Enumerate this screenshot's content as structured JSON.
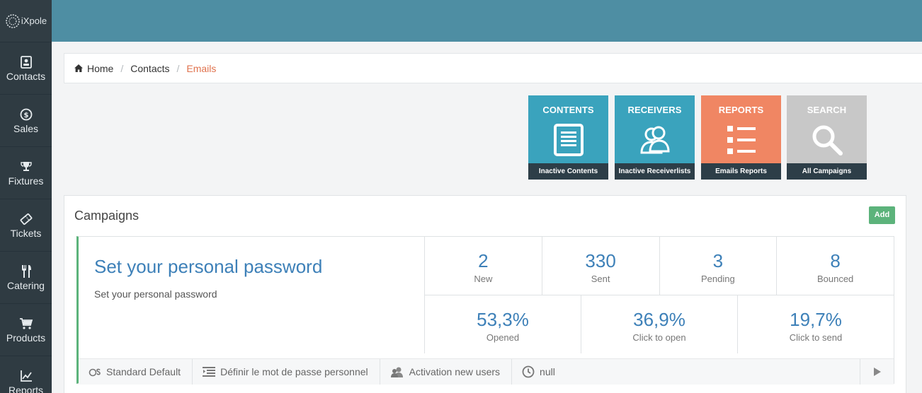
{
  "logo": {
    "text": "iXpole"
  },
  "sidebar": {
    "items": [
      {
        "label": "Contacts",
        "icon": "contacts-icon"
      },
      {
        "label": "Sales",
        "icon": "dollar-icon"
      },
      {
        "label": "Fixtures",
        "icon": "trophy-icon"
      },
      {
        "label": "Tickets",
        "icon": "ticket-icon"
      },
      {
        "label": "Catering",
        "icon": "cutlery-icon"
      },
      {
        "label": "Products",
        "icon": "cart-icon"
      },
      {
        "label": "Reports",
        "icon": "chart-icon"
      }
    ]
  },
  "breadcrumb": {
    "home": "Home",
    "contacts": "Contacts",
    "current": "Emails"
  },
  "tiles": [
    {
      "title": "CONTENTS",
      "footer": "Inactive Contents",
      "color": "#3aa3bd",
      "icon": "document-icon"
    },
    {
      "title": "RECEIVERS",
      "footer": "Inactive Receiverlists",
      "color": "#3aa3bd",
      "icon": "users-icon"
    },
    {
      "title": "REPORTS",
      "footer": "Emails Reports",
      "color": "#f08663",
      "icon": "list-icon"
    },
    {
      "title": "SEARCH",
      "footer": "All Campaigns",
      "color": "#c8c8c8",
      "icon": "search-icon"
    }
  ],
  "campaigns": {
    "title": "Campaigns",
    "add_label": "Add",
    "card": {
      "title": "Set your personal password",
      "subtitle": "Set your personal password",
      "stats_top": [
        {
          "value": "2",
          "label": "New"
        },
        {
          "value": "330",
          "label": "Sent"
        },
        {
          "value": "3",
          "label": "Pending"
        },
        {
          "value": "8",
          "label": "Bounced"
        }
      ],
      "stats_bottom": [
        {
          "value": "53,3%",
          "label": "Opened"
        },
        {
          "value": "36,9%",
          "label": "Click to open"
        },
        {
          "value": "19,7%",
          "label": "Click to send"
        }
      ],
      "footer": {
        "template": "Standard Default",
        "content": "Définir le mot de passe personnel",
        "receivers": "Activation new users",
        "schedule": "null"
      }
    }
  },
  "colors": {
    "sidebar": "#2f3b42",
    "topbar": "#4e8ea3",
    "accent_blue": "#3d80b8",
    "accent_orange": "#e0734e",
    "accent_green": "#5cb37b"
  }
}
